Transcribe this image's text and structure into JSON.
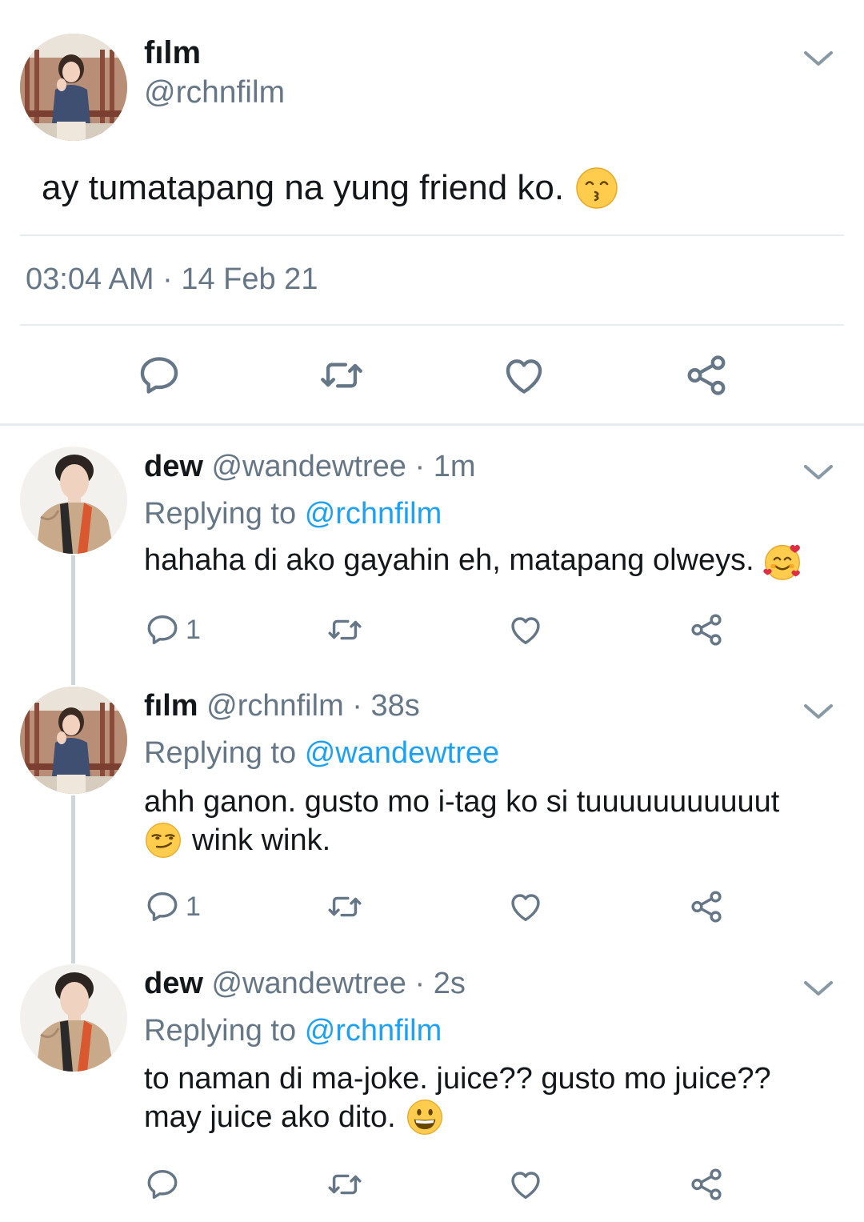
{
  "main_tweet": {
    "display_name": "fılm",
    "handle": "@rchnfilm",
    "text": "ay tumatapang na yung friend ko.",
    "emoji": "kissing-face-smiling-eyes",
    "timestamp": "03:04 AM · 14 Feb 21"
  },
  "replies": [
    {
      "display_name": "dew",
      "handle": "@wandewtree",
      "time": "· 1m",
      "replying_label": "Replying to",
      "replying_to": "@rchnfilm",
      "text_line1": "hahaha di ako gayahin eh, matapang olweys.",
      "text_line2": "",
      "emoji": "smiling-face-with-hearts",
      "reply_count": "1"
    },
    {
      "display_name": "fılm",
      "handle": "@rchnfilm",
      "time": "· 38s",
      "replying_label": "Replying to",
      "replying_to": "@wandewtree",
      "text_line1": "ahh ganon. gusto mo i-tag ko si tuuuuuuuuuuut",
      "text_line2": "wink wink.",
      "emoji": "smirking-face",
      "reply_count": "1"
    },
    {
      "display_name": "dew",
      "handle": "@wandewtree",
      "time": "· 2s",
      "replying_label": "Replying to",
      "replying_to": "@rchnfilm",
      "text_line1": "to naman di ma-joke. juice?? gusto mo juice??",
      "text_line2": "may juice ako dito.",
      "emoji": "grinning-face",
      "reply_count": ""
    }
  ],
  "colors": {
    "text": "#14171a",
    "secondary": "#657786",
    "mention": "#1da1f2",
    "divider": "#e6ecf0",
    "thread_line": "#ccd6dd"
  }
}
